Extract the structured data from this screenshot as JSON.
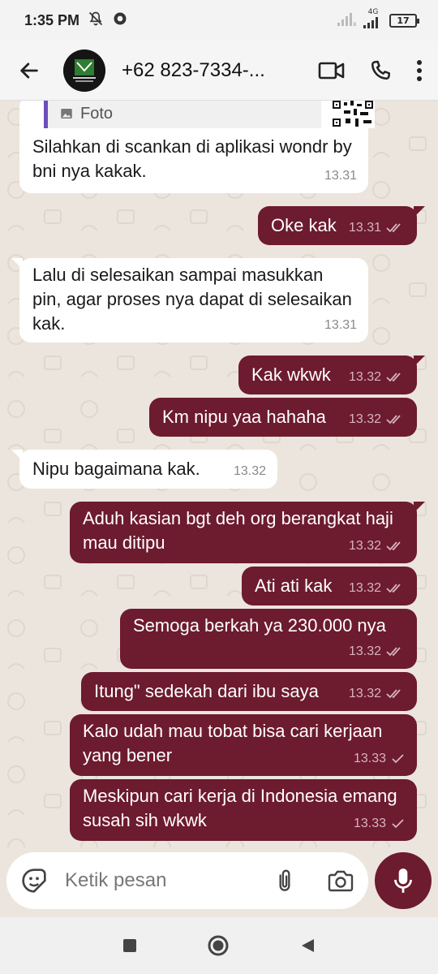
{
  "status_bar": {
    "time": "1:35 PM",
    "network_label": "4G",
    "battery_level": "17"
  },
  "header": {
    "contact_name": "+62 823-7334-...",
    "icons": [
      "back-arrow-icon",
      "video-call-icon",
      "phone-icon",
      "more-options-icon"
    ]
  },
  "chat": {
    "quote_label": "Foto",
    "messages": [
      {
        "dir": "in",
        "text": "Silahkan di scankan di aplikasi wondr by bni nya kakak.",
        "time": "13.31"
      },
      {
        "dir": "out",
        "text": "Oke kak",
        "time": "13.31",
        "status": "read"
      },
      {
        "dir": "in",
        "text": "Lalu di selesaikan sampai masukkan pin, agar proses nya dapat di selesaikan kak.",
        "time": "13.31"
      },
      {
        "dir": "out",
        "text": "Kak wkwk",
        "time": "13.32",
        "status": "read"
      },
      {
        "dir": "out",
        "text": "Km nipu yaa hahaha",
        "time": "13.32",
        "status": "read"
      },
      {
        "dir": "in",
        "text": "Nipu bagaimana kak.",
        "time": "13.32"
      },
      {
        "dir": "out",
        "text": "Aduh kasian bgt deh org berangkat haji mau ditipu",
        "time": "13.32",
        "status": "read"
      },
      {
        "dir": "out",
        "text": "Ati ati kak",
        "time": "13.32",
        "status": "read"
      },
      {
        "dir": "out",
        "text": "Semoga berkah ya 230.000 nya",
        "time": "13.32",
        "status": "read"
      },
      {
        "dir": "out",
        "text": "Itung\" sedekah dari ibu saya",
        "time": "13.32",
        "status": "read"
      },
      {
        "dir": "out",
        "text": "Kalo udah mau tobat bisa cari kerjaan yang bener",
        "time": "13.33",
        "status": "sent"
      },
      {
        "dir": "out",
        "text": "Meskipun cari kerja di Indonesia emang susah sih wkwk",
        "time": "13.33",
        "status": "sent"
      }
    ]
  },
  "input": {
    "placeholder": "Ketik pesan"
  },
  "colors": {
    "outgoing_bubble": "#6d1b2e",
    "incoming_bubble": "#ffffff",
    "quote_accent": "#6b4fbb"
  }
}
